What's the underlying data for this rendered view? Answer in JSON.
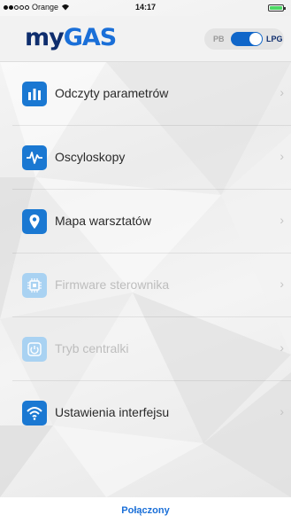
{
  "status_bar": {
    "carrier": "Orange",
    "time": "14:17",
    "signal_bars": 2
  },
  "header": {
    "logo_part1": "my",
    "logo_part2": "GAS",
    "fuel_toggle": {
      "left_label": "PB",
      "right_label": "LPG",
      "selected": "LPG"
    }
  },
  "menu": {
    "items": [
      {
        "label": "Odczyty parametrów",
        "icon": "bar-chart-icon",
        "enabled": true
      },
      {
        "label": "Oscyloskopy",
        "icon": "waveform-icon",
        "enabled": true
      },
      {
        "label": "Mapa warsztatów",
        "icon": "map-pin-icon",
        "enabled": true
      },
      {
        "label": "Firmware sterownika",
        "icon": "chip-icon",
        "enabled": false
      },
      {
        "label": "Tryb centralki",
        "icon": "power-icon",
        "enabled": false
      },
      {
        "label": "Ustawienia interfejsu",
        "icon": "wifi-icon",
        "enabled": true
      }
    ],
    "chevron": "›"
  },
  "footer": {
    "connection_status": "Połączony"
  },
  "colors": {
    "accent": "#1a78d2",
    "accent_disabled": "#a9d2f2",
    "logo_dark": "#0f2e6e"
  }
}
